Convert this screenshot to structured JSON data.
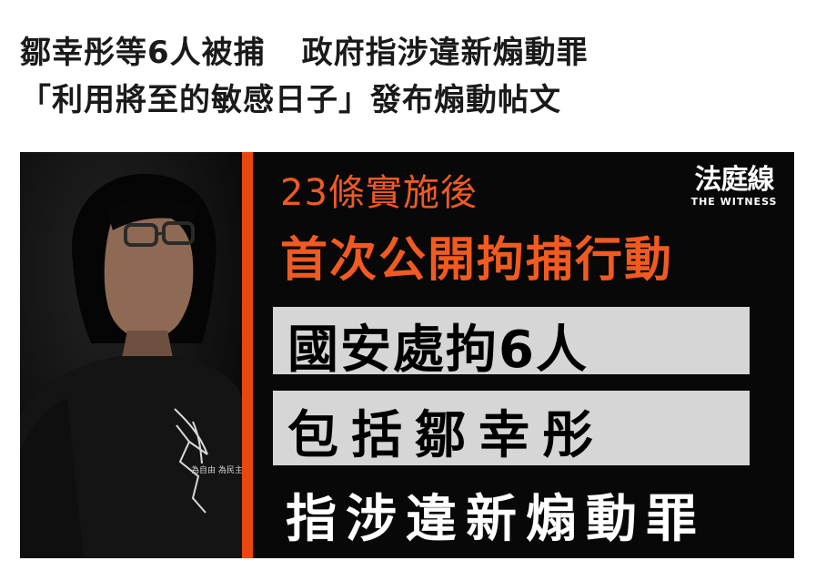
{
  "headline": {
    "line1_part1": "鄒幸彤等6人被捕",
    "line1_part2": "政府指涉違新煽動罪",
    "line2": "「利用將至的敏感日子」發布煽動帖文"
  },
  "image": {
    "kicker": "23條實施後",
    "lead": "首次公開拘捕行動",
    "box1": "國安處拘6人",
    "box2": "包括鄒幸彤",
    "last": "指涉違新煽動罪",
    "logo": {
      "main": "法庭線",
      "sub": "THE WITNESS"
    },
    "shirt_text": "為自由 為民主 再戰"
  },
  "colors": {
    "accent_orange": "#f25a20",
    "divider": "#e8480f",
    "box_gray": "#d6d6d6",
    "background_dark": "#080808"
  }
}
